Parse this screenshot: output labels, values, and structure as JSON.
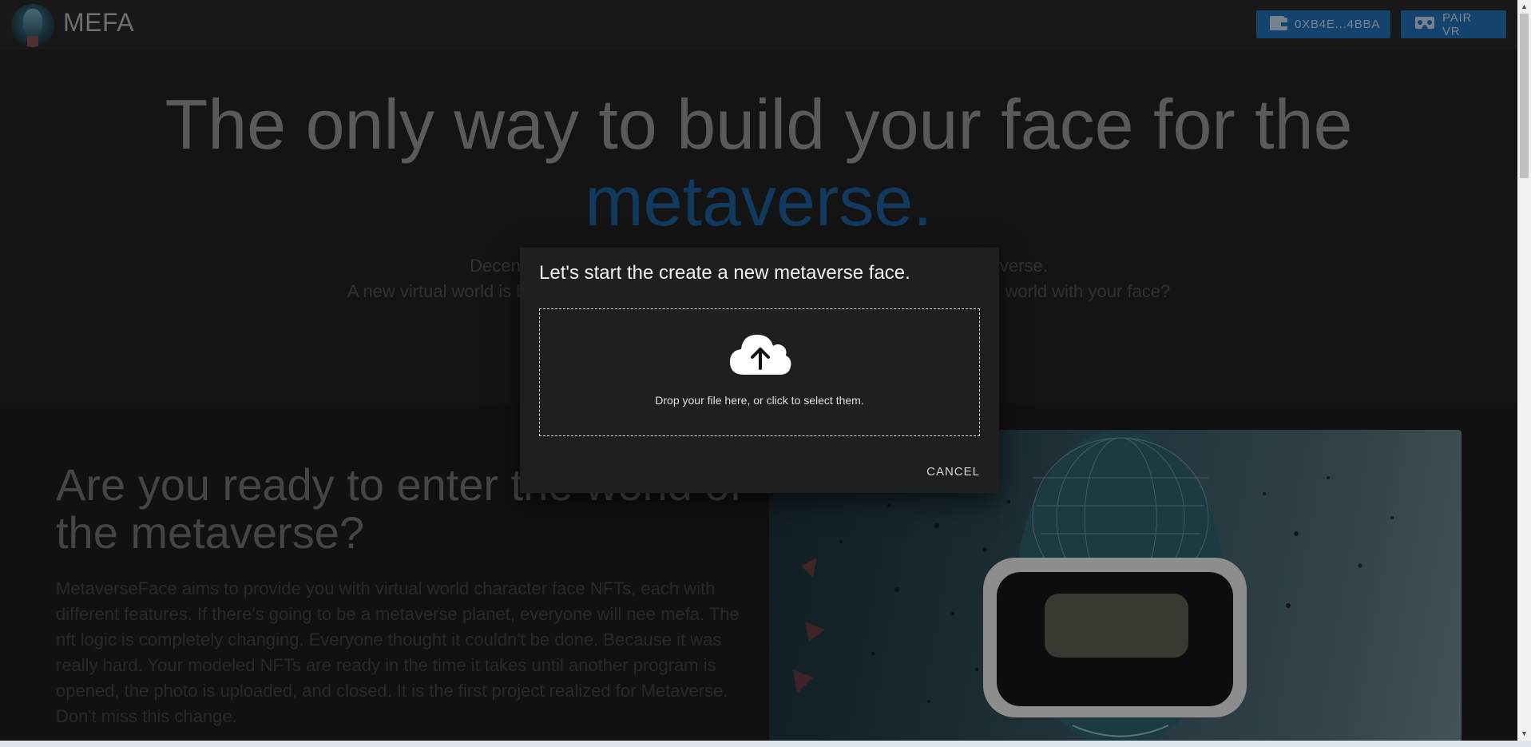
{
  "header": {
    "brand": "MEFA",
    "wallet_button": "0XB4E...4BBA",
    "vr_button": "PAIR VR",
    "icons": {
      "wallet": "wallet-icon",
      "vr": "vr-headset-icon"
    },
    "accent_color": "#1f68a8"
  },
  "hero": {
    "headline_main": "The only way to build your face for the",
    "headline_accent": "metaverse.",
    "subtitle_line1_start": "Decen",
    "subtitle_line1_end": "verse.",
    "subtitle_line2_start": "A new virtual world is b",
    "subtitle_line2_end": "world with your face?"
  },
  "section2": {
    "title": "Are you ready to enter the world of the metaverse?",
    "body": "MetaverseFace aims to provide you with virtual world character face NFTs, each with different features. If there's going to be a metaverse planet, everyone will nee mefa. The nft logic is completely changing. Everyone thought it couldn't be done. Because it was really hard. Your modeled NFTs are ready in the time it takes until another program is opened, the photo is uploaded, and closed. It is the first project realized for Metaverse. Don't miss this change."
  },
  "dialog": {
    "title": "Let's start the create a new metaverse face.",
    "dropzone_hint": "Drop your file here, or click to select them.",
    "upload_icon": "cloud-upload-icon",
    "cancel_label": "CANCEL"
  }
}
